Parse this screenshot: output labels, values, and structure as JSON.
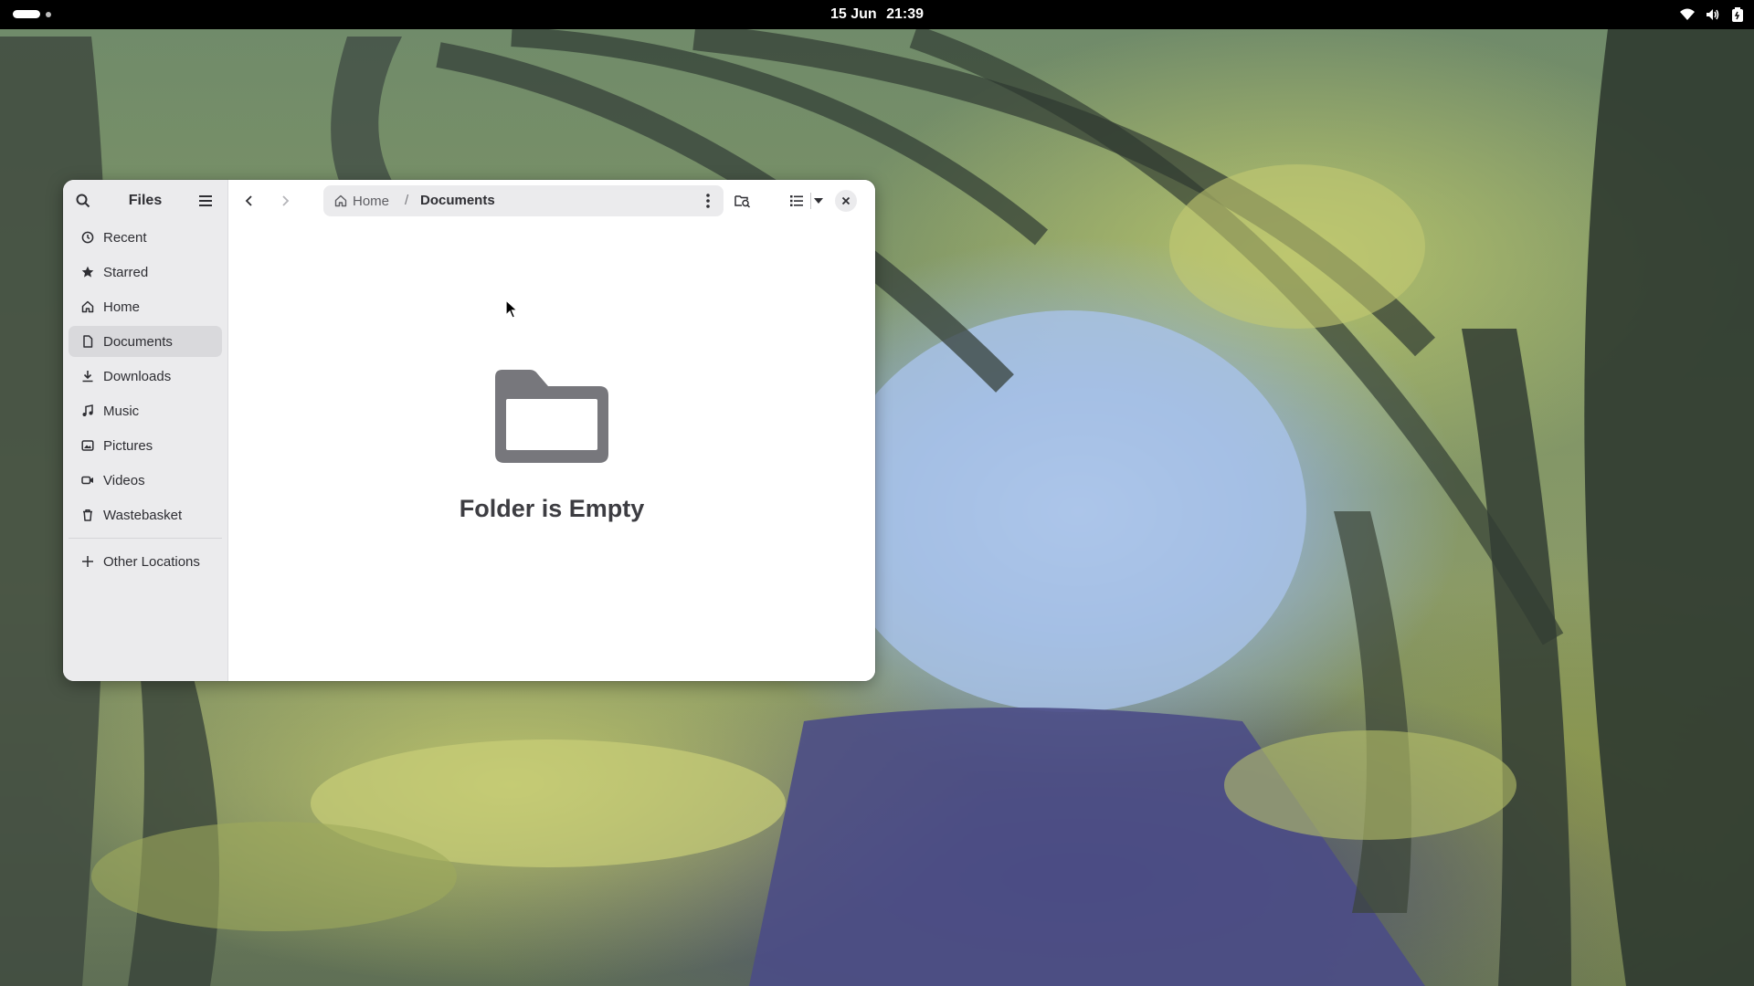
{
  "topbar": {
    "date": "15 Jun",
    "time": "21:39",
    "icons": [
      "wifi-icon",
      "volume-icon",
      "battery-icon"
    ]
  },
  "window": {
    "sidebar_title": "Files",
    "nav_items": [
      {
        "label": "Recent",
        "icon": "clock-icon"
      },
      {
        "label": "Starred",
        "icon": "star-icon"
      },
      {
        "label": "Home",
        "icon": "home-icon"
      },
      {
        "label": "Documents",
        "icon": "document-icon",
        "active": true
      },
      {
        "label": "Downloads",
        "icon": "download-icon"
      },
      {
        "label": "Music",
        "icon": "music-icon"
      },
      {
        "label": "Pictures",
        "icon": "picture-icon"
      },
      {
        "label": "Videos",
        "icon": "video-icon"
      },
      {
        "label": "Wastebasket",
        "icon": "trash-icon"
      }
    ],
    "other_locations": "Other Locations",
    "path": {
      "home": "Home",
      "separator": "/",
      "current": "Documents"
    },
    "empty_state": {
      "title": "Folder is Empty",
      "icon": "folder-icon"
    }
  },
  "colors": {
    "window_bg": "#ffffff",
    "sidebar_bg": "#ebebed",
    "active_item": "#d9d9dc",
    "topbar": "#000000"
  }
}
